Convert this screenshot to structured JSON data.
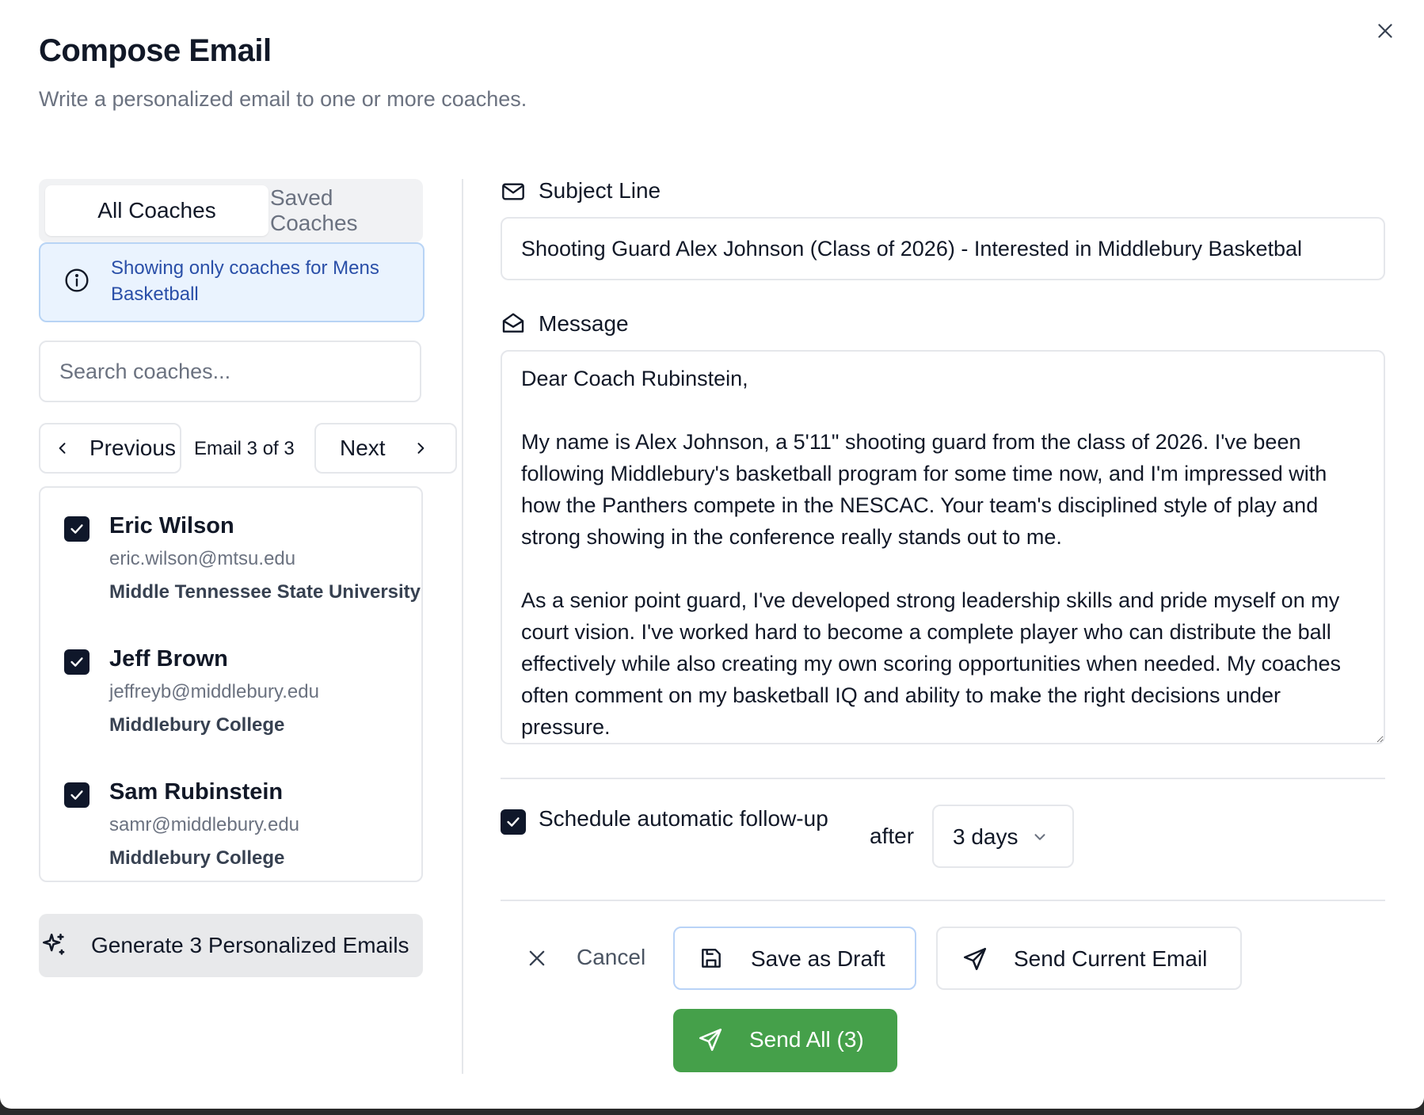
{
  "dialog": {
    "title": "Compose Email",
    "subtitle": "Write a personalized email to one or more coaches."
  },
  "tabs": [
    {
      "label": "All Coaches",
      "active": true
    },
    {
      "label": "Saved Coaches",
      "active": false
    }
  ],
  "filter_notice": "Showing only coaches for Mens Basketball",
  "search": {
    "placeholder": "Search coaches...",
    "value": ""
  },
  "pager": {
    "previous_label": "Previous",
    "next_label": "Next",
    "status": "Email 3 of 3"
  },
  "coaches": [
    {
      "name": "Eric Wilson",
      "email": "eric.wilson@mtsu.edu",
      "school": "Middle Tennessee State University",
      "checked": true
    },
    {
      "name": "Jeff Brown",
      "email": "jeffreyb@middlebury.edu",
      "school": "Middlebury College",
      "checked": true
    },
    {
      "name": "Sam Rubinstein",
      "email": "samr@middlebury.edu",
      "school": "Middlebury College",
      "checked": true
    }
  ],
  "generate_button": "Generate 3 Personalized Emails",
  "subject": {
    "label": "Subject Line",
    "value": "Shooting Guard Alex Johnson (Class of 2026) - Interested in Middlebury Basketbal"
  },
  "message": {
    "label": "Message",
    "value": "Dear Coach Rubinstein,\n\nMy name is Alex Johnson, a 5'11\" shooting guard from the class of 2026. I've been following Middlebury's basketball program for some time now, and I'm impressed with how the Panthers compete in the NESCAC. Your team's disciplined style of play and strong showing in the conference really stands out to me.\n\nAs a senior point guard, I've developed strong leadership skills and pride myself on my court vision. I've worked hard to become a complete player who can distribute the ball effectively while also creating my own scoring opportunities when needed. My coaches often comment on my basketball IQ and ability to make the right decisions under pressure."
  },
  "followup": {
    "label": "Schedule automatic follow-up",
    "checked": true,
    "after_label": "after",
    "selected": "3 days"
  },
  "actions": {
    "cancel": "Cancel",
    "save_draft": "Save as Draft",
    "send_current": "Send Current Email",
    "send_all": "Send All (3)"
  },
  "colors": {
    "accent_dark": "#0f172a",
    "send_all_green": "#45a04a",
    "info_bg": "#eaf3fe",
    "info_text": "#2a4fa8"
  }
}
